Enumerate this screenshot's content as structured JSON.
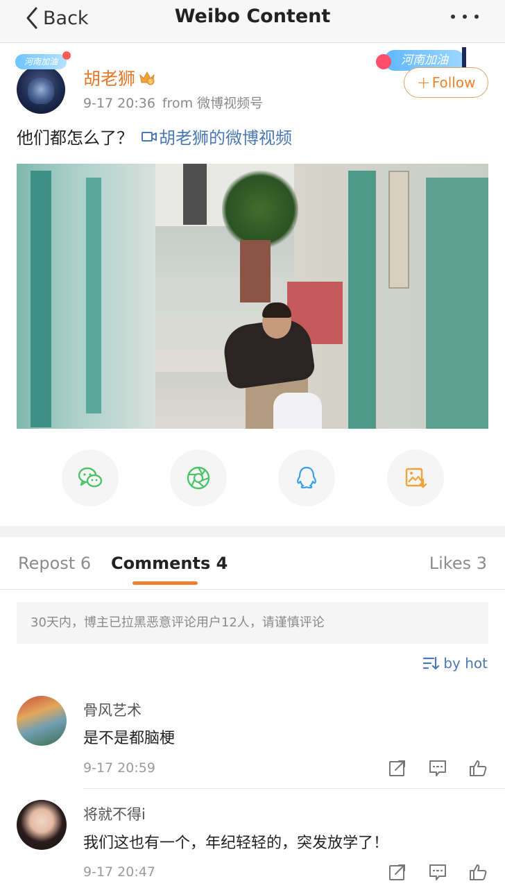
{
  "nav": {
    "back_label": "Back",
    "title": "Weibo Content"
  },
  "post": {
    "author": "胡老狮",
    "avatar_badge": "河南加油",
    "decoration_badge": "河南加油",
    "time": "9-17 20:36",
    "source": "from 微博视频号",
    "follow_label": "Follow",
    "text": "他们都怎么了？",
    "video_link": "胡老狮的微博视频"
  },
  "share": {
    "icons": [
      "wechat-icon",
      "moments-icon",
      "qq-icon",
      "save-image-icon"
    ]
  },
  "tabs": {
    "repost": "Repost 6",
    "comments": "Comments 4",
    "likes": "Likes 3"
  },
  "notice": "30天内，博主已拉黑恶意评论用户12人，请谨慎评论",
  "sort_label": "by hot",
  "comments": [
    {
      "name": "骨风艺术",
      "text": "是不是都脑梗",
      "time": "9-17 20:59"
    },
    {
      "name": "将就不得i",
      "text": "我们这也有一个，年纪轻轻的，突发放学了！",
      "time": "9-17 20:47"
    }
  ],
  "colors": {
    "accent_orange": "#f08030",
    "link_blue": "#4a79b6",
    "username_orange": "#e5772a"
  }
}
